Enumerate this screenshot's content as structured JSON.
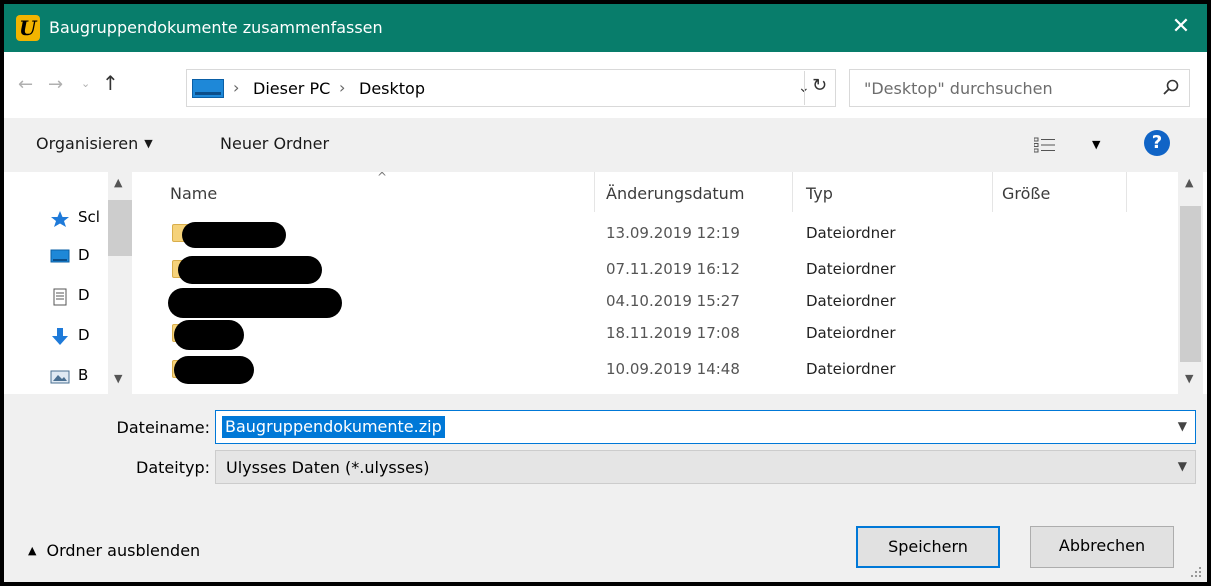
{
  "window": {
    "title": "Baugruppendokumente zusammenfassen",
    "close_glyph": "✕",
    "app_icon": "ulysses-logo-icon"
  },
  "nav": {
    "back_glyph": "←",
    "forward_glyph": "→",
    "recent_glyph": "⌄",
    "up_glyph": "↑",
    "breadcrumbs": [
      "Dieser PC",
      "Desktop"
    ],
    "separator": "›",
    "dropdown_glyph": "⌄",
    "refresh_glyph": "↻",
    "search_placeholder": "\"Desktop\" durchsuchen"
  },
  "toolbar": {
    "organize_label": "Organisieren",
    "new_folder_label": "Neuer Ordner",
    "help_glyph": "?"
  },
  "navpane": {
    "items": [
      {
        "label": "Scl",
        "icon": "quick-access-star-icon"
      },
      {
        "label": "D",
        "icon": "desktop-icon"
      },
      {
        "label": "D",
        "icon": "documents-icon"
      },
      {
        "label": "D",
        "icon": "downloads-icon"
      },
      {
        "label": "B",
        "icon": "pictures-icon"
      }
    ]
  },
  "filelist": {
    "columns": [
      "Name",
      "Änderungsdatum",
      "Typ",
      "Größe"
    ],
    "rows": [
      {
        "date": "13.09.2019 12:19",
        "type": "Dateiordner"
      },
      {
        "date": "07.11.2019 16:12",
        "type": "Dateiordner"
      },
      {
        "date": "04.10.2019 15:27",
        "type": "Dateiordner"
      },
      {
        "date": "18.11.2019 17:08",
        "type": "Dateiordner"
      },
      {
        "date": "10.09.2019 14:48",
        "type": "Dateiordner"
      }
    ]
  },
  "form": {
    "filename_label": "Dateiname:",
    "filename_value": "Baugruppendokumente.zip",
    "filetype_label": "Dateityp:",
    "filetype_value": "Ulysses Daten (*.ulysses)"
  },
  "footer": {
    "hide_folders_label": "Ordner ausblenden",
    "save_label": "Speichern",
    "cancel_label": "Abbrechen"
  },
  "colors": {
    "titlebar": "#087d6b",
    "selection": "#0078d7",
    "folder": "#f5d27a",
    "help": "#1064c6"
  }
}
